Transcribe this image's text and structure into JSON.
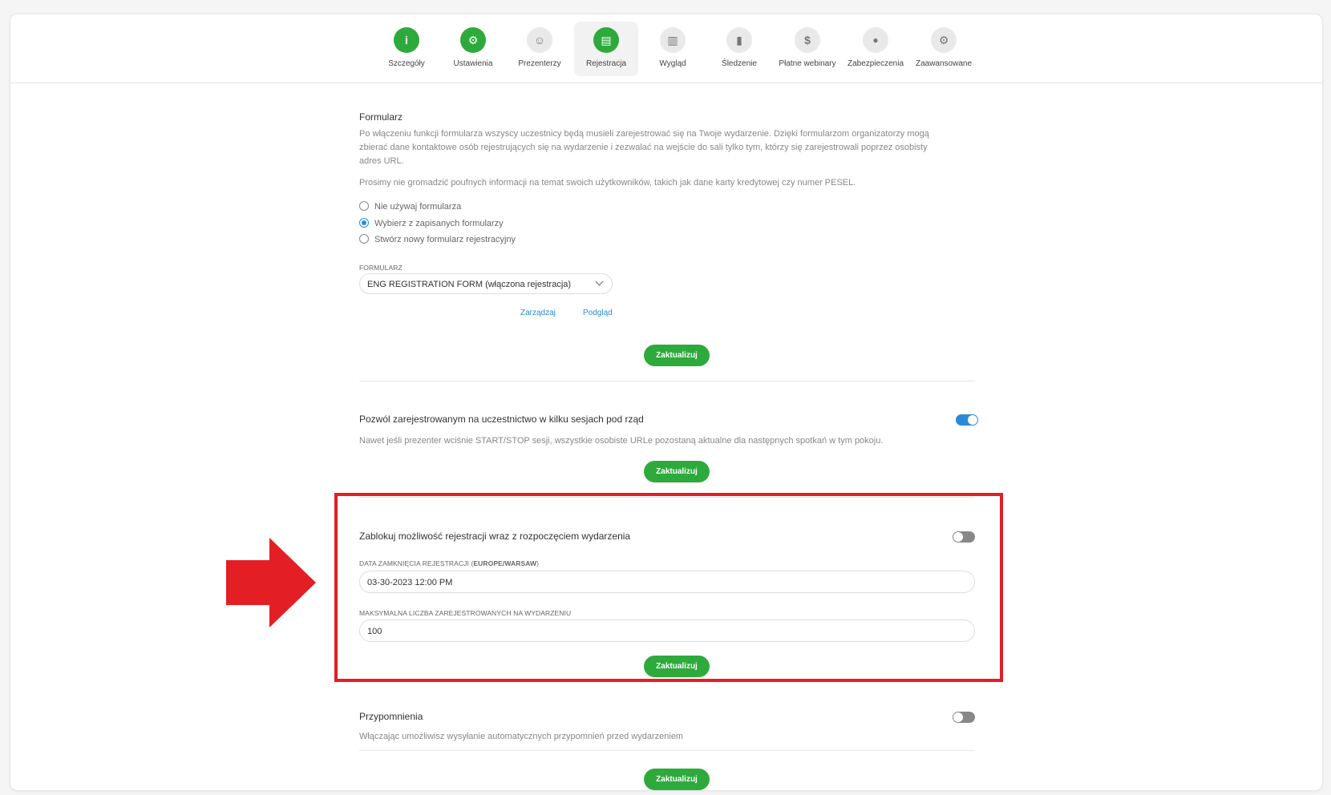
{
  "tabs": [
    {
      "label": "Szczegóły",
      "icon": "info-icon",
      "glyph": "i",
      "active": false,
      "green": true
    },
    {
      "label": "Ustawienia",
      "icon": "gear-icon",
      "glyph": "⚙",
      "active": false,
      "green": true
    },
    {
      "label": "Prezenterzy",
      "icon": "presenter-face-icon",
      "glyph": "☺",
      "active": false,
      "green": false
    },
    {
      "label": "Rejestracja",
      "icon": "registration-form-icon",
      "glyph": "▤",
      "active": true,
      "green": true
    },
    {
      "label": "Wygląd",
      "icon": "layout-icon",
      "glyph": "▥",
      "active": false,
      "green": false
    },
    {
      "label": "Śledzenie",
      "icon": "chart-icon",
      "glyph": "▮",
      "active": false,
      "green": false
    },
    {
      "label": "Płatne webinary",
      "icon": "dollar-icon",
      "glyph": "$",
      "active": false,
      "green": false
    },
    {
      "label": "Zabezpieczenia",
      "icon": "lock-icon",
      "glyph": "🔒",
      "active": false,
      "green": false
    },
    {
      "label": "Zaawansowane",
      "icon": "advanced-settings-icon",
      "glyph": "⚙",
      "active": false,
      "green": false
    }
  ],
  "form_section": {
    "title": "Formularz",
    "description": "Po włączeniu funkcji formularza wszyscy uczestnicy będą musieli zarejestrować się na Twoje wydarzenie. Dzięki formularzom organizatorzy mogą zbierać dane kontaktowe osób rejestrujących się na wydarzenie i zezwalać na wejście do sali tylko tym, którzy się zarejestrowali poprzez osobisty adres URL.",
    "notice": "Prosimy nie gromadzić poufnych informacji na temat swoich użytkowników, takich jak dane karty kredytowej czy numer PESEL.",
    "options": [
      {
        "label": "Nie używaj formularza",
        "selected": false
      },
      {
        "label": "Wybierz z zapisanych formularzy",
        "selected": true
      },
      {
        "label": "Stwórz nowy formularz rejestracyjny",
        "selected": false
      }
    ],
    "select_label": "FORMULARZ",
    "select_value": "ENG REGISTRATION FORM (włączona rejestracja)",
    "manage_link": "Zarządzaj",
    "preview_link": "Podgląd",
    "update_label": "Zaktualizuj"
  },
  "multi_session": {
    "title": "Pozwól zarejestrowanym na uczestnictwo w kilku sesjach pod rząd",
    "description": "Nawet jeśli prezenter wciśnie START/STOP sesji, wszystkie osobiste URLe pozostaną aktualne dla następnych spotkań w tym pokoju.",
    "enabled": true,
    "update_label": "Zaktualizuj"
  },
  "block_registration": {
    "title": "Zablokuj możliwość rejestracji wraz z rozpoczęciem wydarzenia",
    "enabled": false,
    "close_date_label_prefix": "DATA ZAMKNIĘCIA REJESTRACJI (",
    "close_date_tz": "EUROPE/WARSAW",
    "close_date_label_suffix": ")",
    "close_date_value": "03-30-2023 12:00 PM",
    "max_label": "MAKSYMALNA LICZBA ZAREJESTROWANYCH NA WYDARZENIU",
    "max_value": "100",
    "update_label": "Zaktualizuj"
  },
  "reminders": {
    "title": "Przypomnienia",
    "description": "Włączając umożliwisz wysyłanie automatycznych przypomnień przed wydarzeniem",
    "enabled": false,
    "update_label": "Zaktualizuj"
  },
  "colors": {
    "accent_green": "#2eaa3c",
    "link_blue": "#2b8ad8",
    "highlight_red": "#e31e24"
  }
}
